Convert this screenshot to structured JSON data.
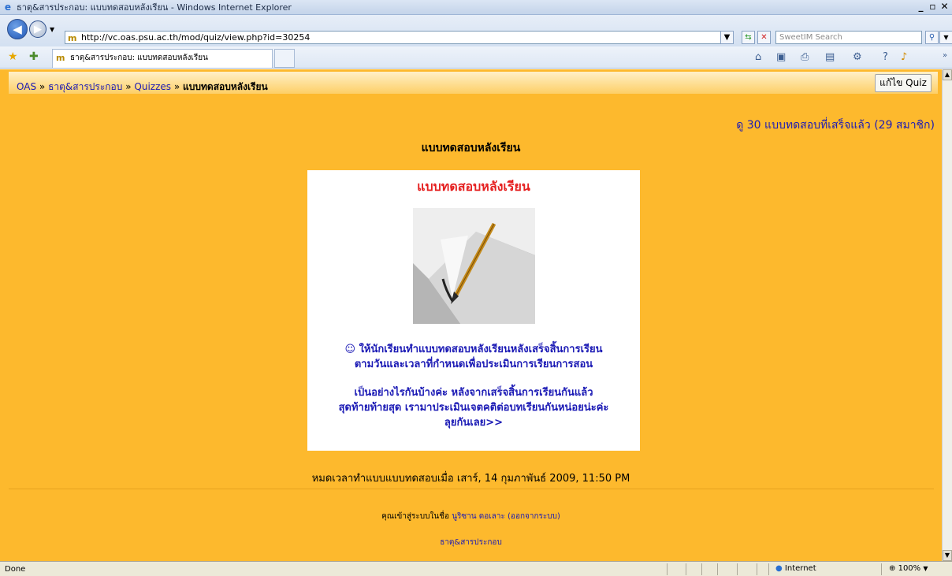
{
  "window": {
    "title": "ธาตุ&สารประกอบ: แบบทดสอบหลังเรียน - Windows Internet Explorer",
    "minimize": "_",
    "maximize": "▫",
    "close": "✕"
  },
  "address_bar": {
    "url": "http://vc.oas.psu.ac.th/mod/quiz/view.php?id=30254",
    "search_placeholder": "SweetIM Search"
  },
  "tab": {
    "title": "ธาตุ&สารประกอบ: แบบทดสอบหลังเรียน"
  },
  "navbar": {
    "breadcrumb": [
      {
        "label": "OAS"
      },
      {
        "label": "ธาตุ&สารประกอบ"
      },
      {
        "label": "Quizzes"
      }
    ],
    "separator": "»",
    "current": "แบบทดสอบหลังเรียน",
    "edit_button": "แก้ไข Quiz"
  },
  "main": {
    "attempts_link": "ดู 30 แบบทดสอบที่เสร็จแล้ว (29 สมาชิก)",
    "quiz_title": "แบบทดสอบหลังเรียน",
    "intro": {
      "title": "แบบทดสอบหลังเรียน",
      "paragraph1_line1": "☺ ให้นักเรียนทำแบบทดสอบหลังเรียนหลังเสร็จสิ้นการเรียน",
      "paragraph1_line2": "ตามวันและเวลาที่กำหนดเพื่อประเมินการเรียนการสอน",
      "paragraph2_line1": "เป็นอย่างไรกันบ้างค่ะ หลังจากเสร็จสิ้นการเรียนกันแล้ว",
      "paragraph2_line2": "สุดท้ายท้ายสุด เรามาประเมินเจตคติต่อบทเรียนกันหน่อยน่ะค่ะ",
      "paragraph2_line3": "ลุยกันเลย>>"
    },
    "closed_text": "หมดเวลาทำแบบแบบทดสอบเมื่อ เสาร์, 14 กุมภาพันธ์ 2009, 11:50 PM"
  },
  "footer": {
    "login_prefix": "คุณเข้าสู่ระบบในชื่อ",
    "user_name": "นูริซาน ดอเลาะ",
    "logout_link": "(ออกจากระบบ)",
    "course_link": "ธาตุ&สารประกอบ"
  },
  "status_bar": {
    "status": "Done",
    "zone": "Internet",
    "zoom": "100%"
  },
  "colors": {
    "page_background": "#fdb92d",
    "link": "#1b1ab5",
    "intro_title": "#e52020"
  }
}
